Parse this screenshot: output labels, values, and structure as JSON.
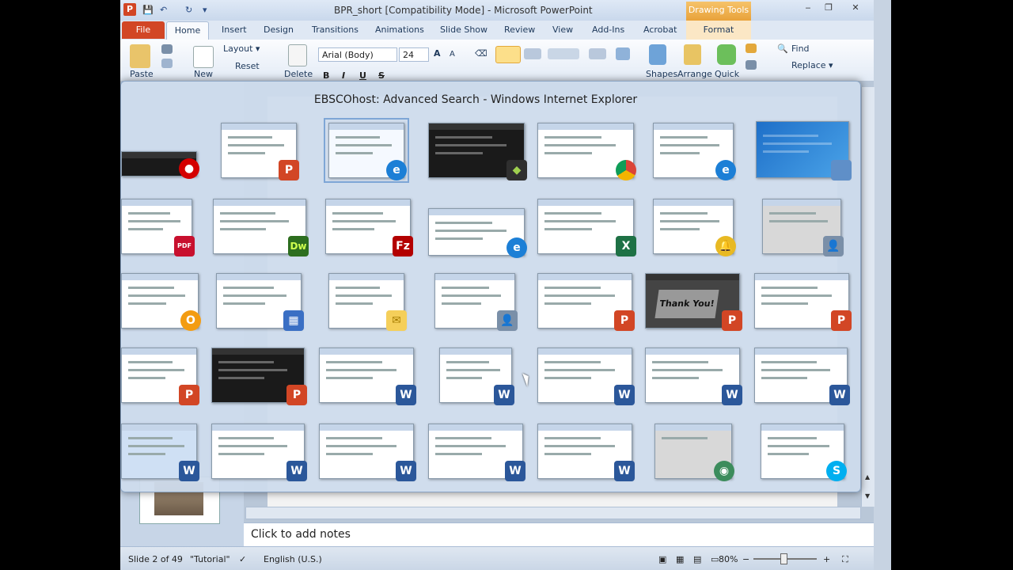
{
  "window": {
    "title": "BPR_short [Compatibility Mode] - Microsoft PowerPoint",
    "app_icon": "P",
    "contextual_label": "Drawing Tools",
    "controls": [
      "‒",
      "❐",
      "✕"
    ]
  },
  "qat": {
    "save": "💾",
    "undo": "↶",
    "redo": "↻",
    "more": "▾"
  },
  "tabs": [
    {
      "label": "File"
    },
    {
      "label": "Home"
    },
    {
      "label": "Insert"
    },
    {
      "label": "Design"
    },
    {
      "label": "Transitions"
    },
    {
      "label": "Animations"
    },
    {
      "label": "Slide Show"
    },
    {
      "label": "Review"
    },
    {
      "label": "View"
    },
    {
      "label": "Add-Ins"
    },
    {
      "label": "Acrobat"
    },
    {
      "label": "Format"
    }
  ],
  "ribbon": {
    "paste": "Paste",
    "new": "New",
    "layout": "Layout ▾",
    "reset": "Reset",
    "delete": "Delete",
    "font": "Arial (Body)",
    "size": "24",
    "shapes": "Shapes",
    "arrange": "Arrange",
    "quick": "Quick",
    "find": "Find",
    "replace": "Replace ▾",
    "bold": "B",
    "italic": "I",
    "underline": "U",
    "strike": "S",
    "grow": "A",
    "shrink": "A"
  },
  "switcher": {
    "title": "EBSCOhost: Advanced Search - Windows Internet Explorer",
    "badges": {
      "ppt": "P",
      "ie": "e",
      "dw": "Dw",
      "fz": "Fz",
      "xl": "X",
      "pdf": "PDF",
      "word": "W",
      "mail": "✉",
      "outlook": "O",
      "cal": "▦",
      "bell": "🔔",
      "user": "👤",
      "skype": "S",
      "globe": "◉",
      "sys": "◆",
      "rec": "●"
    },
    "thankyou": "Thank You!"
  },
  "notes": {
    "placeholder": "Click to add notes"
  },
  "status": {
    "slide": "Slide 2 of 49",
    "theme": "\"Tutorial\"",
    "language": "English (U.S.)",
    "zoom": "80%",
    "zoom_minus": "−",
    "zoom_plus": "+"
  }
}
